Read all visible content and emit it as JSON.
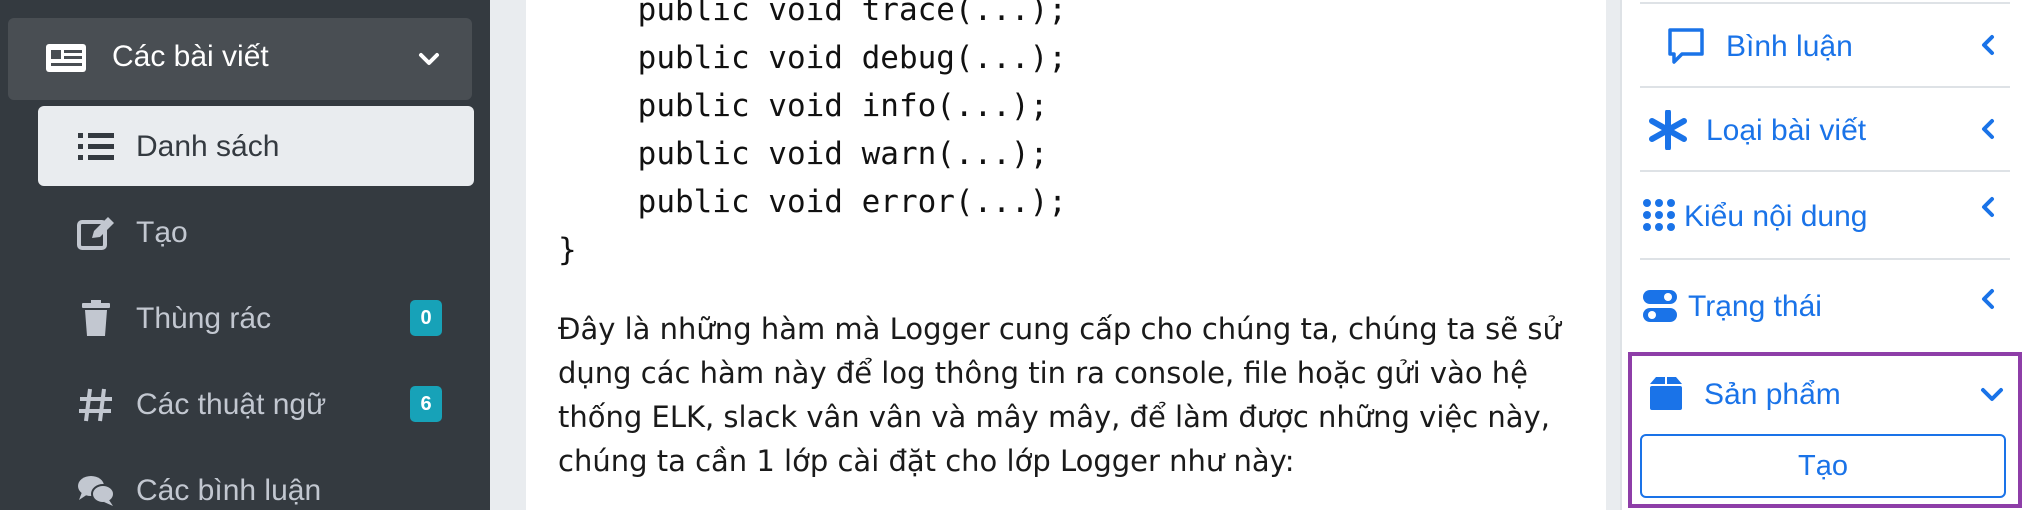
{
  "sidebar": {
    "group": {
      "label": "Các bài viết",
      "icon": "newspaper-icon"
    },
    "items": [
      {
        "label": "Danh sách",
        "icon": "list-icon",
        "active": true
      },
      {
        "label": "Tạo",
        "icon": "edit-icon"
      },
      {
        "label": "Thùng rác",
        "icon": "trash-icon",
        "badge": "0"
      },
      {
        "label": "Các thuật ngữ",
        "icon": "hashtag-icon",
        "badge": "6"
      },
      {
        "label": "Các bình luận",
        "icon": "comments-icon"
      }
    ]
  },
  "article": {
    "code_lines": [
      "    public void trace(...);",
      "    public void debug(...);",
      "    public void info(...);",
      "    public void warn(...);",
      "    public void error(...);",
      "}"
    ],
    "paragraph_lines": [
      "Đây là những hàm mà Logger cung cấp cho chúng ta, chúng ta sẽ sử",
      "dụng các hàm này để log thông tin ra console, file hoặc gửi vào hệ",
      "thống ELK, slack vân vân và mây mây, để làm được những việc này,",
      "chúng ta cần 1 lớp cài đặt cho lớp Logger như này:"
    ]
  },
  "right_panel": {
    "items": [
      {
        "label": "Bình luận",
        "icon": "comment-icon"
      },
      {
        "label": "Loại bài viết",
        "icon": "asterisk-icon"
      },
      {
        "label": "Kiểu nội dung",
        "icon": "grid-icon"
      },
      {
        "label": "Trạng thái",
        "icon": "toggle-icon"
      }
    ],
    "product": {
      "label": "Sản phẩm",
      "icon": "box-icon",
      "create_label": "Tạo"
    }
  },
  "colors": {
    "accent": "#1a73e8",
    "highlight": "#8e3ea8",
    "badge": "#17a2b8",
    "sidebar_bg": "#343a40"
  }
}
